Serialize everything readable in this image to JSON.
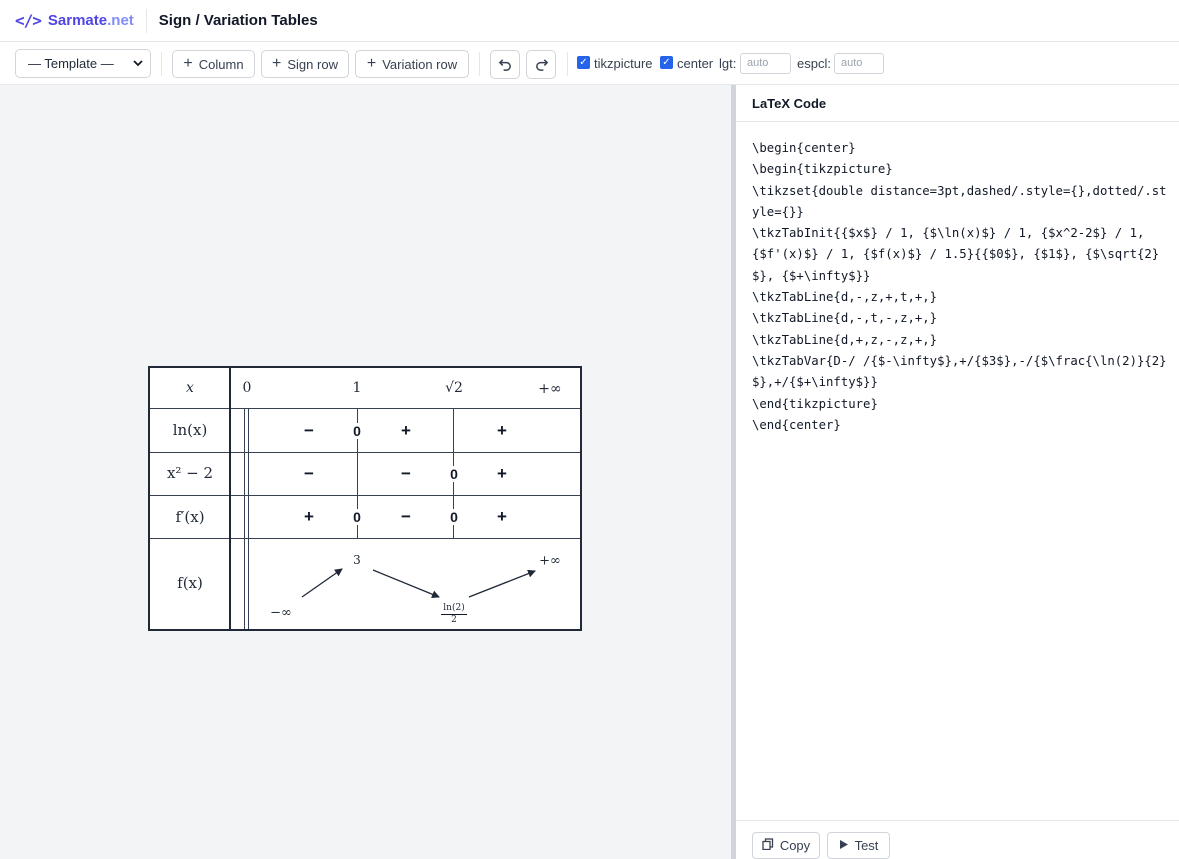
{
  "header": {
    "brand_icon": "</>",
    "brand_name": "Sarmate",
    "brand_tld": ".net",
    "title": "Sign / Variation Tables"
  },
  "toolbar": {
    "template_select": "— Template —",
    "add_column": "Column",
    "add_sign_row": "Sign row",
    "add_variation_row": "Variation row",
    "undo_icon": "undo-icon",
    "redo_icon": "redo-icon",
    "tikzpicture_label": "tikzpicture",
    "tikzpicture_checked": true,
    "center_label": "center",
    "center_checked": true,
    "lgt_label": "lgt:",
    "lgt_placeholder": "auto",
    "espcl_label": "espcl:",
    "espcl_placeholder": "auto"
  },
  "table": {
    "header_label": "x",
    "x_values": [
      "0",
      "1",
      "√2",
      "+∞"
    ],
    "rows": [
      {
        "label": "ln(x)",
        "signs": [
          "−",
          "0",
          "+",
          "+"
        ]
      },
      {
        "label": "x² − 2",
        "signs": [
          "−",
          "−",
          "0",
          "+"
        ]
      },
      {
        "label": "f′(x)",
        "signs": [
          "+",
          "0",
          "−",
          "0",
          "+"
        ]
      }
    ],
    "variation": {
      "label": "f(x)",
      "values": [
        "−∞",
        "3",
        "ln(2)",
        "2",
        "+∞"
      ]
    }
  },
  "code_panel": {
    "title": "LaTeX Code",
    "code": "\\begin{center}\n\\begin{tikzpicture}\n\\tikzset{double distance=3pt,dashed/.style={},dotted/.style={}}\n\\tkzTabInit{{$x$} / 1, {$\\ln(x)$} / 1, {$x^2-2$} / 1, {$f'(x)$} / 1, {$f(x)$} / 1.5}{{$0$}, {$1$}, {$\\sqrt{2}$}, {$+\\infty$}}\n\\tkzTabLine{d,-,z,+,t,+,}\n\\tkzTabLine{d,-,t,-,z,+,}\n\\tkzTabLine{d,+,z,-,z,+,}\n\\tkzTabVar{D-/ /{$-\\infty$},+/{$3$},-/{$\\frac{\\ln(2)}{2}$},+/{$+\\infty$}}\n\\end{tikzpicture}\n\\end{center}",
    "copy_label": "Copy",
    "test_label": "Test"
  }
}
